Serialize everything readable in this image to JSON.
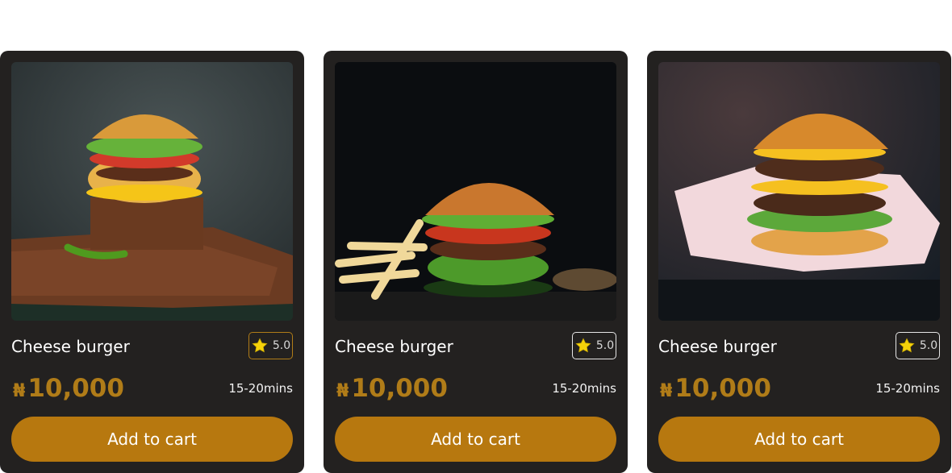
{
  "products": [
    {
      "name": "Cheese burger",
      "rating": "5.0",
      "currency": "₦",
      "price": "10,000",
      "time": "15-20mins",
      "cta": "Add to cart",
      "image_icon": "cheeseburger-on-wooden-board-photo"
    },
    {
      "name": "Cheese burger",
      "rating": "5.0",
      "currency": "₦",
      "price": "10,000",
      "time": "15-20mins",
      "cta": "Add to cart",
      "image_icon": "burger-with-fries-photo"
    },
    {
      "name": "Cheese burger",
      "rating": "5.0",
      "currency": "₦",
      "price": "10,000",
      "time": "15-20mins",
      "cta": "Add to cart",
      "image_icon": "double-cheeseburger-on-paper-photo"
    }
  ],
  "colors": {
    "card": "#232120",
    "accent": "#b7780f",
    "price": "#b07c18",
    "star": "#f5d20a"
  }
}
